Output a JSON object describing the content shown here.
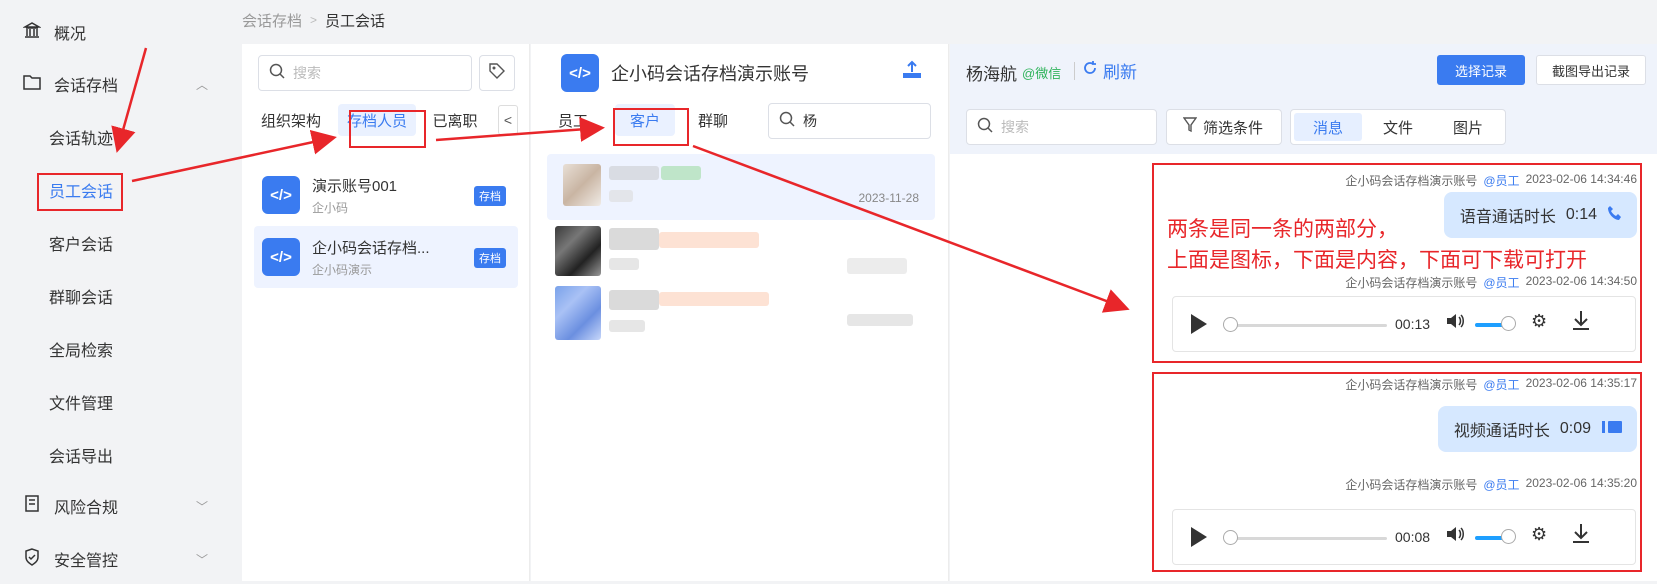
{
  "sidebar": {
    "items": [
      {
        "label": "概况",
        "icon": "bank-icon",
        "level": "top"
      },
      {
        "label": "会话存档",
        "icon": "folder-icon",
        "level": "top",
        "expanded": true
      },
      {
        "label": "会话轨迹",
        "level": "sub"
      },
      {
        "label": "员工会话",
        "level": "sub",
        "active": true
      },
      {
        "label": "客户会话",
        "level": "sub"
      },
      {
        "label": "群聊会话",
        "level": "sub"
      },
      {
        "label": "全局检索",
        "level": "sub"
      },
      {
        "label": "文件管理",
        "level": "sub"
      },
      {
        "label": "会话导出",
        "level": "sub"
      },
      {
        "label": "风险合规",
        "icon": "book-icon",
        "level": "top",
        "expanded": false
      },
      {
        "label": "安全管控",
        "icon": "shield-icon",
        "level": "top",
        "expanded": false
      }
    ]
  },
  "breadcrumb": {
    "parent": "会话存档",
    "current": "员工会话"
  },
  "staff_panel": {
    "search_placeholder": "搜索",
    "tabs": [
      "组织架构",
      "存档人员",
      "已离职"
    ],
    "active_tab": "存档人员",
    "accounts": [
      {
        "name": "演示账号001",
        "sub": "企小码",
        "badge": "存档"
      },
      {
        "name": "企小码会话存档...",
        "sub": "企小码演示",
        "badge": "存档"
      }
    ]
  },
  "chat_panel": {
    "account_title": "企小码会话存档演示账号",
    "tabs": [
      "员工",
      "客户",
      "群聊"
    ],
    "active_tab": "客户",
    "search_value": "杨",
    "items": [
      {
        "date": "2023-11-28"
      },
      {
        "date": ""
      },
      {
        "date": ""
      }
    ]
  },
  "message_panel": {
    "contact_name": "杨海航",
    "contact_source": "@微信",
    "refresh_label": "刷新",
    "select_records_label": "选择记录",
    "export_label": "截图导出记录",
    "search_placeholder": "搜索",
    "filter_label": "筛选条件",
    "segments": [
      "消息",
      "文件",
      "图片"
    ],
    "active_segment": "消息",
    "messages": [
      {
        "sender": "企小码会话存档演示账号",
        "role": "@员工",
        "time": "2023-02-06 14:34:46",
        "bubble_text": "语音通话时长",
        "duration": "0:14",
        "icon": "phone-icon"
      },
      {
        "sender": "企小码会话存档演示账号",
        "role": "@员工",
        "time": "2023-02-06 14:34:50",
        "player_time": "00:13"
      },
      {
        "sender": "企小码会话存档演示账号",
        "role": "@员工",
        "time": "2023-02-06 14:35:17",
        "bubble_text": "视频通话时长",
        "duration": "0:09",
        "icon": "video-icon"
      },
      {
        "sender": "企小码会话存档演示账号",
        "role": "@员工",
        "time": "2023-02-06 14:35:20",
        "player_time": "00:08"
      }
    ]
  },
  "annotation": {
    "line1": "两条是同一条的两部分，",
    "line2": "上面是图标，下面是内容，下面可下载可打开",
    "color": "#e8262a"
  },
  "colors": {
    "accent": "#3a7bf0",
    "bubble": "#d6e8ff",
    "annotation": "#e8262a"
  }
}
